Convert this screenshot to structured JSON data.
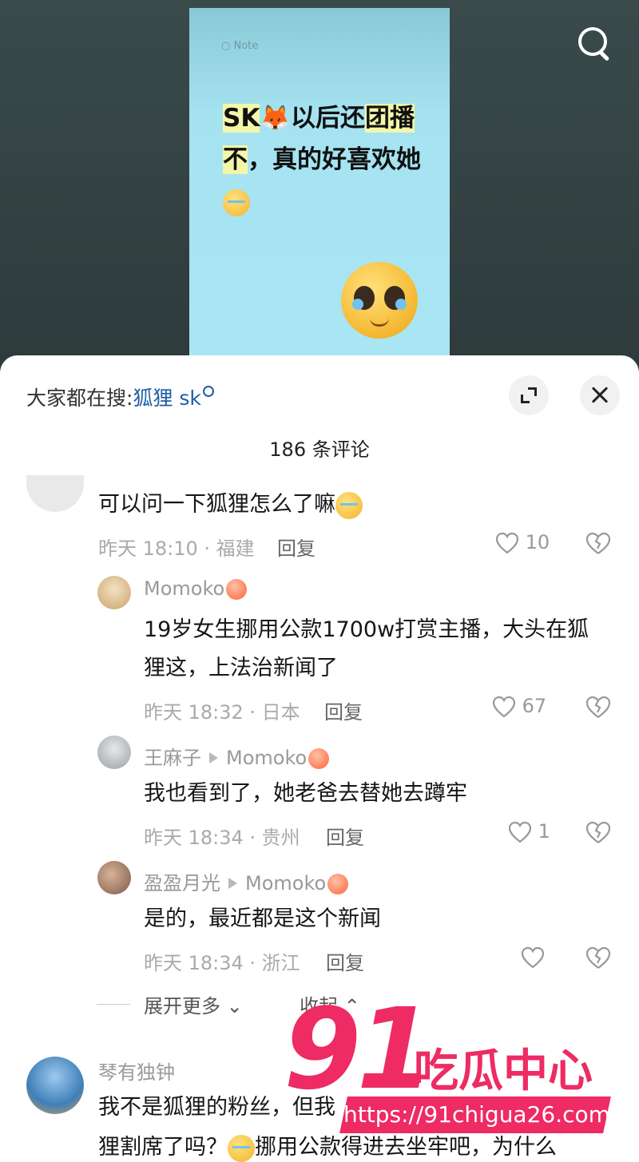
{
  "note": {
    "tag": "Note",
    "text_parts": [
      "SK",
      "以后还",
      "团",
      "播不",
      "，真的好喜欢她"
    ]
  },
  "search_hint": {
    "prefix": "大家都在搜:",
    "keyword": "狐狸 sk"
  },
  "comment_count": "186 条评论",
  "comments": [
    {
      "text": "可以问一下狐狸怎么了嘛",
      "meta": "昨天 18:10 · 福建",
      "reply": "回复",
      "likes": "10"
    },
    {
      "user": "Momoko",
      "text": "19岁女生挪用公款1700w打赏主播，大头在狐狸这，上法治新闻了",
      "meta": "昨天 18:32 · 日本",
      "reply": "回复",
      "likes": "67"
    },
    {
      "user": "王麻子",
      "to": "Momoko",
      "text": "我也看到了，她老爸去替她去蹲牢",
      "meta": "昨天 18:34 · 贵州",
      "reply": "回复",
      "likes": "1"
    },
    {
      "user": "盈盈月光",
      "to": "Momoko",
      "text": "是的，最近都是这个新闻",
      "meta": "昨天 18:34 · 浙江",
      "reply": "回复",
      "likes": ""
    },
    {
      "user": "琴有独钟",
      "text_line1": "我不是狐狸的粉丝，但我",
      "text_line2": "狸割席了吗？",
      "text_line2b": "挪用公款得进去坐牢吧，为什么"
    }
  ],
  "expand_more": "展开更多",
  "collapse": "收起",
  "watermark": {
    "num": "91",
    "cn": "吃瓜中心",
    "url": "https://91chigua26.com"
  },
  "colors": {
    "accent_link": "#1e5fa3",
    "watermark": "#ee2b63",
    "note_bg": "#a8e6f4"
  }
}
